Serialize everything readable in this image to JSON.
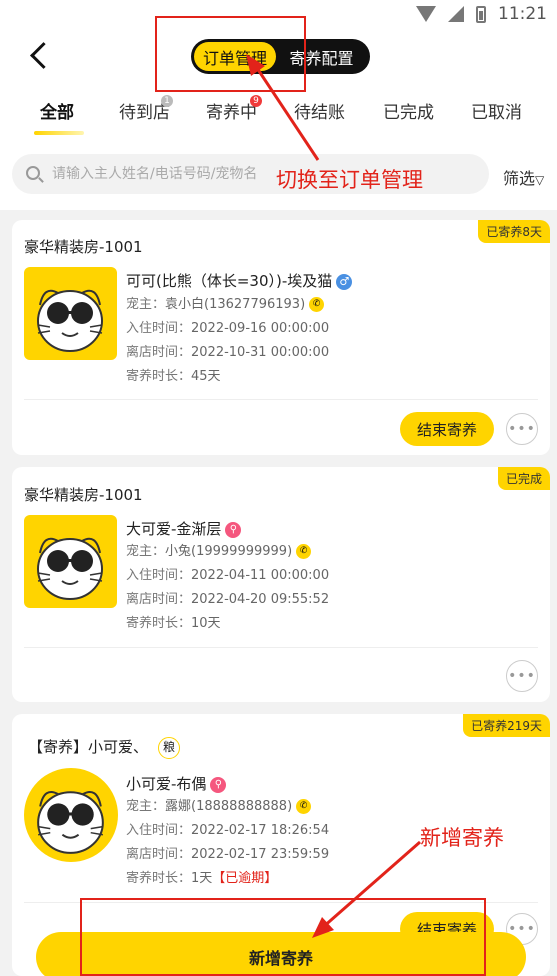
{
  "status_bar": {
    "time": "11:21"
  },
  "header": {
    "segments": [
      "订单管理",
      "寄养配置"
    ],
    "tabs": [
      {
        "label": "全部"
      },
      {
        "label": "待到店",
        "badge": "1"
      },
      {
        "label": "寄养中",
        "badge": "9"
      },
      {
        "label": "待结账"
      },
      {
        "label": "已完成"
      },
      {
        "label": "已取消"
      }
    ],
    "search_placeholder": "请输入主人姓名/电话号码/宠物名",
    "filter_label": "筛选"
  },
  "annotations": {
    "switch_note": "切换至订单管理",
    "add_note": "新增寄养"
  },
  "orders": [
    {
      "status": "已寄养8天",
      "room": "豪华精装房-1001",
      "pet_name": "可可(比熊（体长=30）)-埃及猫",
      "gender_icon": "male-icon",
      "owner_label": "宠主：",
      "owner": "袁小白(13627796193)",
      "checkin_label": "入住时间：",
      "checkin": "2022-09-16 00:00:00",
      "checkout_label": "离店时间：",
      "checkout": "2022-10-31 00:00:00",
      "duration_label": "寄养时长：",
      "duration": "45天",
      "action": "结束寄养"
    },
    {
      "status": "已完成",
      "room": "豪华精装房-1001",
      "pet_name": "大可爱-金渐层",
      "owner_label": "宠主：",
      "owner": "小兔(19999999999)",
      "checkin_label": "入住时间：",
      "checkin": "2022-04-11 00:00:00",
      "checkout_label": "离店时间：",
      "checkout": "2022-04-20 09:55:52",
      "duration_label": "寄养时长：",
      "duration": "10天"
    },
    {
      "status": "已寄养219天",
      "room": "【寄养】小可爱、",
      "grain_badge": "粮",
      "pet_name": "小可爱-布偶",
      "owner_label": "宠主：",
      "owner": "露娜(18888888888)",
      "checkin_label": "入住时间：",
      "checkin": "2022-02-17 18:26:54",
      "checkout_label": "离店时间：",
      "checkout": "2022-02-17 23:59:59",
      "duration_label": "寄养时长：",
      "duration": "1天",
      "overdue": "【已逾期】",
      "action": "结束寄养"
    }
  ],
  "bottom_button": "新增寄养",
  "colors": {
    "accent": "#ffd400",
    "annotation_red": "#e2231a"
  }
}
